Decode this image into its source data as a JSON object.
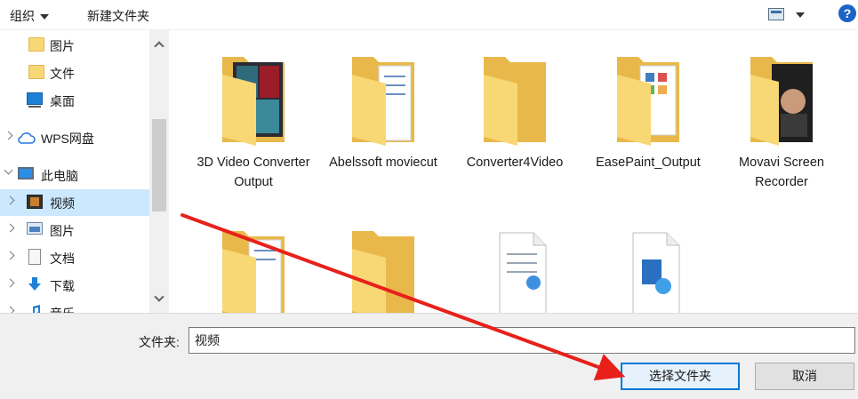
{
  "toolbar": {
    "organize_label": "组织",
    "new_folder_label": "新建文件夹",
    "help_label": "?"
  },
  "nav": {
    "items": [
      {
        "label": "图片",
        "icon": "folder-icon"
      },
      {
        "label": "文件",
        "icon": "folder-icon"
      },
      {
        "label": "桌面",
        "icon": "desktop-icon"
      },
      {
        "label": "WPS网盘",
        "icon": "cloud-icon"
      },
      {
        "label": "此电脑",
        "icon": "computer-icon"
      },
      {
        "label": "视频",
        "icon": "video-icon",
        "selected": true
      },
      {
        "label": "图片",
        "icon": "pictures-icon"
      },
      {
        "label": "文档",
        "icon": "document-icon"
      },
      {
        "label": "下载",
        "icon": "download-icon"
      },
      {
        "label": "音乐",
        "icon": "music-icon"
      }
    ]
  },
  "content": {
    "folders": [
      {
        "label": "3D Video Converter Output",
        "icon": "media-folder-icon"
      },
      {
        "label": "Abelssoft moviecut",
        "icon": "document-folder-icon"
      },
      {
        "label": "Converter4Video",
        "icon": "folder-icon"
      },
      {
        "label": "EasePaint_Output",
        "icon": "image-folder-icon"
      },
      {
        "label": "Movavi Screen Recorder",
        "icon": "photo-folder-icon"
      },
      {
        "label": "",
        "icon": "document-folder-icon"
      },
      {
        "label": "",
        "icon": "folder-icon"
      },
      {
        "label": "",
        "icon": "document-file-icon"
      },
      {
        "label": "",
        "icon": "media-file-icon"
      }
    ]
  },
  "bottom": {
    "folder_label": "文件夹:",
    "folder_value": "视频",
    "select_button": "选择文件夹",
    "cancel_button": "取消"
  },
  "colors": {
    "selection": "#cce8ff",
    "primary_border": "#0078d7",
    "folder": "#f8d775",
    "arrow": "#e8201a"
  }
}
